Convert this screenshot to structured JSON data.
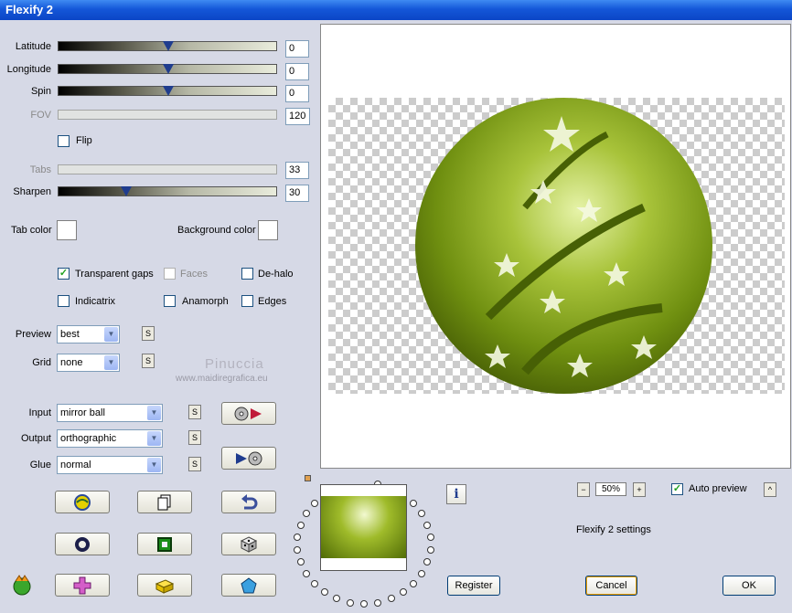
{
  "window": {
    "title": "Flexify 2"
  },
  "sliders": {
    "latitude": {
      "label": "Latitude",
      "value": "0"
    },
    "longitude": {
      "label": "Longitude",
      "value": "0"
    },
    "spin": {
      "label": "Spin",
      "value": "0"
    },
    "fov": {
      "label": "FOV",
      "value": "120"
    },
    "tabs": {
      "label": "Tabs",
      "value": "33"
    },
    "sharpen": {
      "label": "Sharpen",
      "value": "30"
    }
  },
  "flip": {
    "label": "Flip",
    "checked": false
  },
  "colors": {
    "tab_color_label": "Tab color",
    "background_color_label": "Background color"
  },
  "checkboxes": {
    "transparent_gaps": {
      "label": "Transparent gaps",
      "checked": true
    },
    "faces": {
      "label": "Faces",
      "checked": false
    },
    "de_halo": {
      "label": "De-halo",
      "checked": false
    },
    "indicatrix": {
      "label": "Indicatrix",
      "checked": false
    },
    "anamorph": {
      "label": "Anamorph",
      "checked": false
    },
    "edges": {
      "label": "Edges",
      "checked": false
    }
  },
  "selects": {
    "preview": {
      "label": "Preview",
      "value": "best"
    },
    "grid": {
      "label": "Grid",
      "value": "none"
    },
    "input": {
      "label": "Input",
      "value": "mirror ball"
    },
    "output": {
      "label": "Output",
      "value": "orthographic"
    },
    "glue": {
      "label": "Glue",
      "value": "normal"
    }
  },
  "small_button_label": "S",
  "watermark": {
    "name": "Pinuccia",
    "url": "www.maidiregrafica.eu"
  },
  "zoom": {
    "value": "50%",
    "minus": "−",
    "plus": "+"
  },
  "auto_preview": {
    "label": "Auto preview",
    "checked": true,
    "arrow": "^"
  },
  "info_label": "i",
  "settings_text": "Flexify 2 settings",
  "buttons": {
    "register": "Register",
    "cancel": "Cancel",
    "ok": "OK"
  },
  "accent_colors": {
    "titlebar": "#0b45c6",
    "check": "#21a121",
    "ball": "#6f8f10"
  }
}
